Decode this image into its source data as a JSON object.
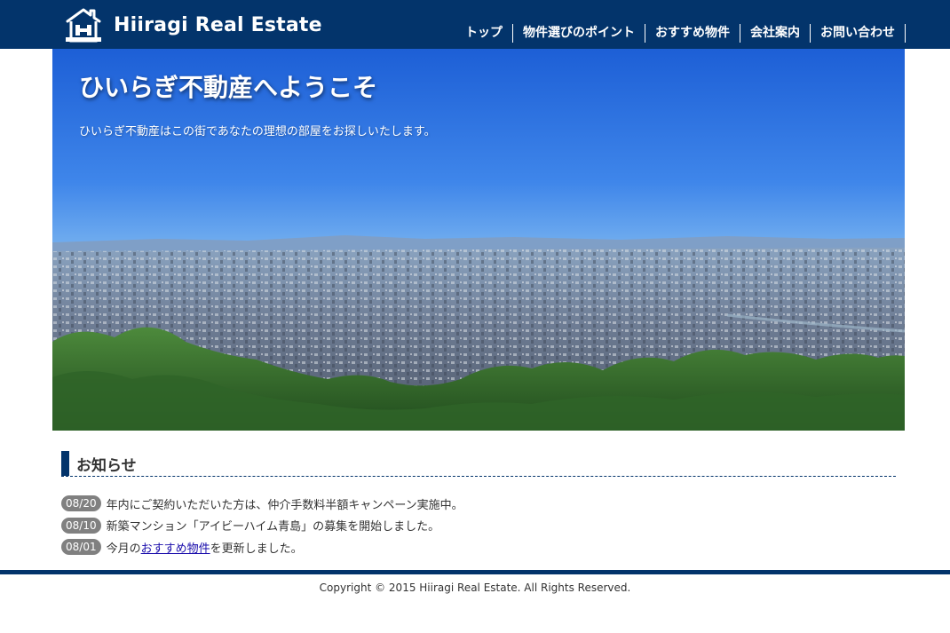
{
  "header": {
    "logo_text": "Hiiragi Real Estate",
    "nav": [
      {
        "label": "トップ"
      },
      {
        "label": "物件選びのポイント"
      },
      {
        "label": "おすすめ物件"
      },
      {
        "label": "会社案内"
      },
      {
        "label": "お問い合わせ"
      }
    ]
  },
  "hero": {
    "title": "ひいらぎ不動産へようこそ",
    "subtitle": "ひいらぎ不動産はこの街であなたの理想の部屋をお探しいたします。"
  },
  "news": {
    "title": "お知らせ",
    "items": [
      {
        "date": "08/20",
        "text": "年内にご契約いただいた方は、仲介手数料半額キャンペーン実施中。"
      },
      {
        "date": "08/10",
        "text": "新築マンション「アイビーハイム青島」の募集を開始しました。"
      },
      {
        "date": "08/01",
        "text_before": "今月の",
        "link": "おすすめ物件",
        "text_after": "を更新しました。"
      }
    ]
  },
  "footer": {
    "copyright": "Copyright © 2015 Hiiragi Real Estate. All Rights Reserved."
  },
  "colors": {
    "brand": "#03346b",
    "badge": "#808080",
    "link": "#1a0dab"
  }
}
